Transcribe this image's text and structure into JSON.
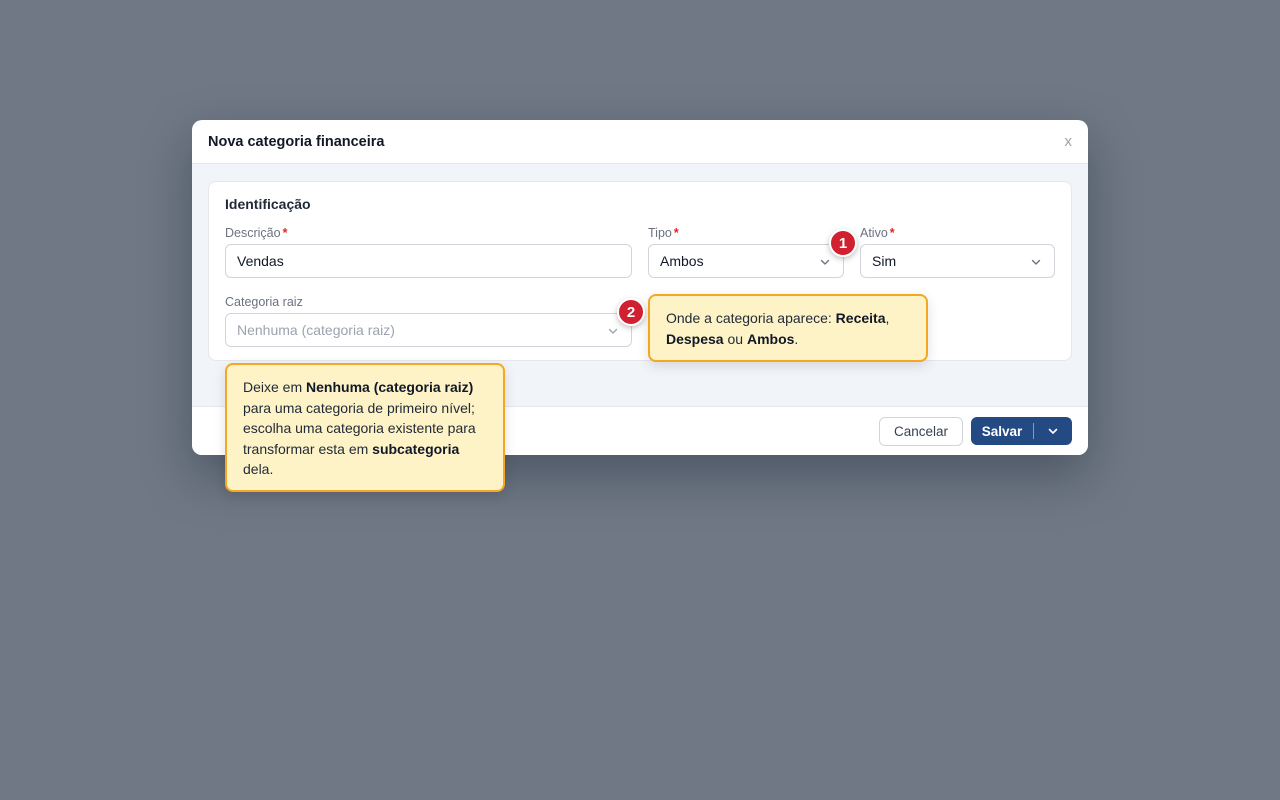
{
  "modal": {
    "title": "Nova categoria financeira",
    "close_label": "x"
  },
  "section": {
    "title": "Identificação"
  },
  "fields": {
    "descricao": {
      "label": "Descrição",
      "required_mark": "*",
      "value": "Vendas"
    },
    "tipo": {
      "label": "Tipo",
      "required_mark": "*",
      "value": "Ambos"
    },
    "ativo": {
      "label": "Ativo",
      "required_mark": "*",
      "value": "Sim"
    },
    "categoria_raiz": {
      "label": "Categoria raiz",
      "placeholder": "Nenhuma (categoria raiz)"
    }
  },
  "footer": {
    "cancel_label": "Cancelar",
    "save_label": "Salvar"
  },
  "badges": {
    "one": "1",
    "two": "2"
  },
  "tooltip_tipo": {
    "p1": "Onde a categoria aparece: ",
    "b1": "Receita",
    "p2": ",",
    "b2": "Despesa",
    "p3": " ou ",
    "b3": "Ambos",
    "p4": "."
  },
  "tooltip_raiz": {
    "p1": "Deixe em ",
    "b1": "Nenhuma (categoria raiz)",
    "p2": " para uma categoria de primeiro nível; escolha uma categoria existente para transformar esta em ",
    "b2": "subcategoria",
    "p3": " dela."
  },
  "colors": {
    "primary": "#244a84",
    "badge": "#d1202f",
    "tooltip_bg": "#fef3c7",
    "tooltip_border": "#f5a623",
    "required": "#dc2626"
  },
  "icons": {
    "dropdown": "chevron-down-icon",
    "close": "close-icon"
  }
}
